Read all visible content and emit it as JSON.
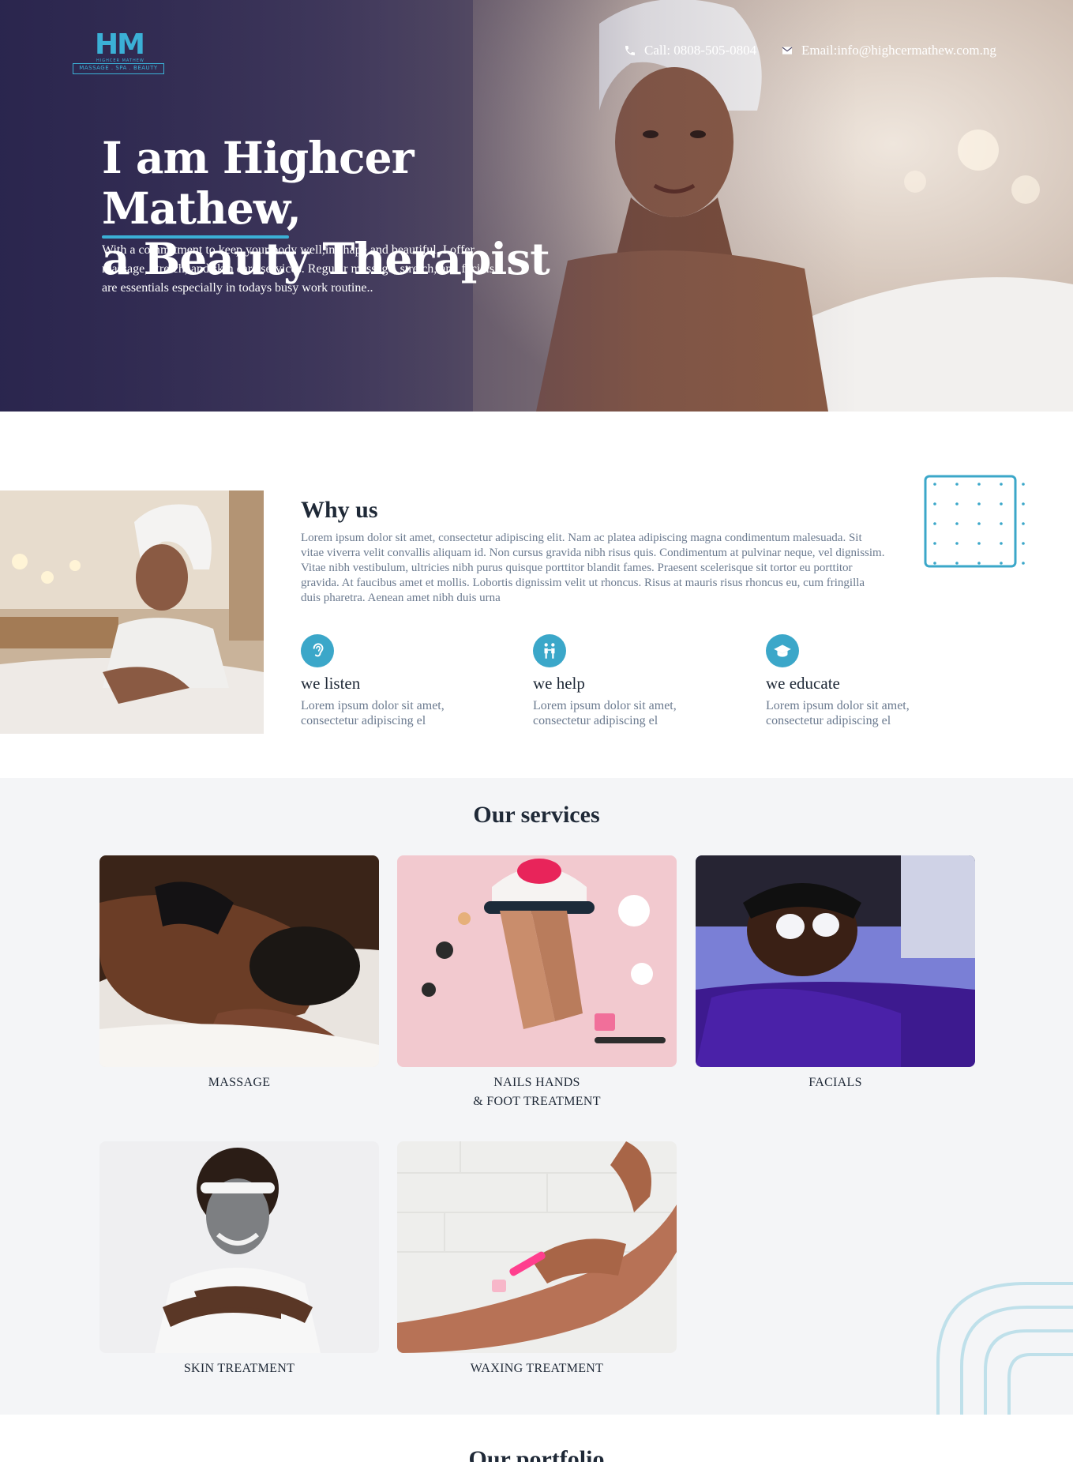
{
  "brand": {
    "logo_mark": "HM",
    "logo_name": "HIGHCER MATHEW",
    "logo_tagline": "MASSAGE . SPA . BEAUTY"
  },
  "header": {
    "phone": "Call: 0808-505-0804",
    "email": "Email:info@highcermathew.com.ng"
  },
  "hero": {
    "title_line1": "I am Highcer Mathew,",
    "title_line2": "a Beauty Therapist",
    "text": "With a commitment to keep your body well,in shape and beautiful. I offer massage, stretch, and skin care services. Regular massage, stretch, and facials are essentials especially in todays busy work routine.."
  },
  "why": {
    "title": "Why us",
    "text": "Lorem ipsum dolor sit amet, consectetur adipiscing elit. Nam ac platea adipiscing magna condimentum malesuada. Sit vitae viverra velit convallis aliquam id. Non cursus gravida nibh risus quis. Condimentum at pulvinar neque, vel dignissim. Vitae nibh vestibulum, ultricies nibh purus quisque porttitor blandit fames. Praesent scelerisque sit tortor eu porttitor gravida. At faucibus amet et mollis. Lobortis dignissim velit ut rhoncus. Risus at mauris risus rhoncus eu, cum fringilla duis pharetra. Aenean amet nibh duis urna",
    "features": [
      {
        "icon": "ear-icon",
        "title": "we listen",
        "text": "Lorem ipsum dolor sit amet, consectetur adipiscing el"
      },
      {
        "icon": "helping-icon",
        "title": "we help",
        "text": "Lorem ipsum dolor sit amet, consectetur adipiscing el"
      },
      {
        "icon": "graduation-cap-icon",
        "title": "we educate",
        "text": "Lorem ipsum dolor sit amet, consectetur adipiscing el"
      }
    ]
  },
  "services": {
    "title": "Our services",
    "items": [
      {
        "line1": "MASSAGE",
        "line2": ""
      },
      {
        "line1": "NAILS HANDS",
        "line2": "& FOOT TREATMENT"
      },
      {
        "line1": "FACIALS",
        "line2": ""
      },
      {
        "line1": "SKIN TREATMENT",
        "line2": ""
      },
      {
        "line1": "WAXING TREATMENT",
        "line2": ""
      }
    ]
  },
  "next_section": {
    "title": "Our portfolio"
  },
  "colors": {
    "accent": "#3bb0d6",
    "hero_dark": "#2f2a4d",
    "services_bg": "#f4f5f7",
    "body_text": "#6b7a8f"
  }
}
